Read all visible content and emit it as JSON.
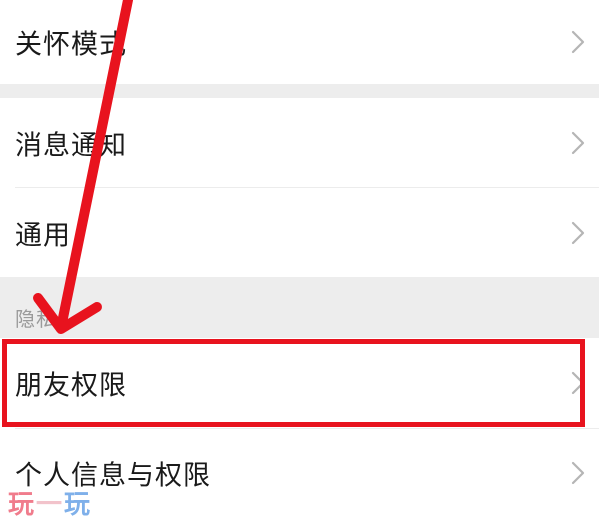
{
  "settings": {
    "rows": {
      "care_mode": "关怀模式",
      "notifications": "消息通知",
      "general": "通用",
      "friend_permissions": "朋友权限",
      "personal_info_permissions": "个人信息与权限"
    },
    "privacy_section_label": "隐私"
  },
  "icons": {
    "chevron": "chevron-right-icon",
    "arrow": "red-arrow-annotation"
  },
  "annotation": {
    "color": "#e8131e"
  },
  "watermark": {
    "char1": "玩",
    "char2": "一",
    "char3": "玩"
  }
}
